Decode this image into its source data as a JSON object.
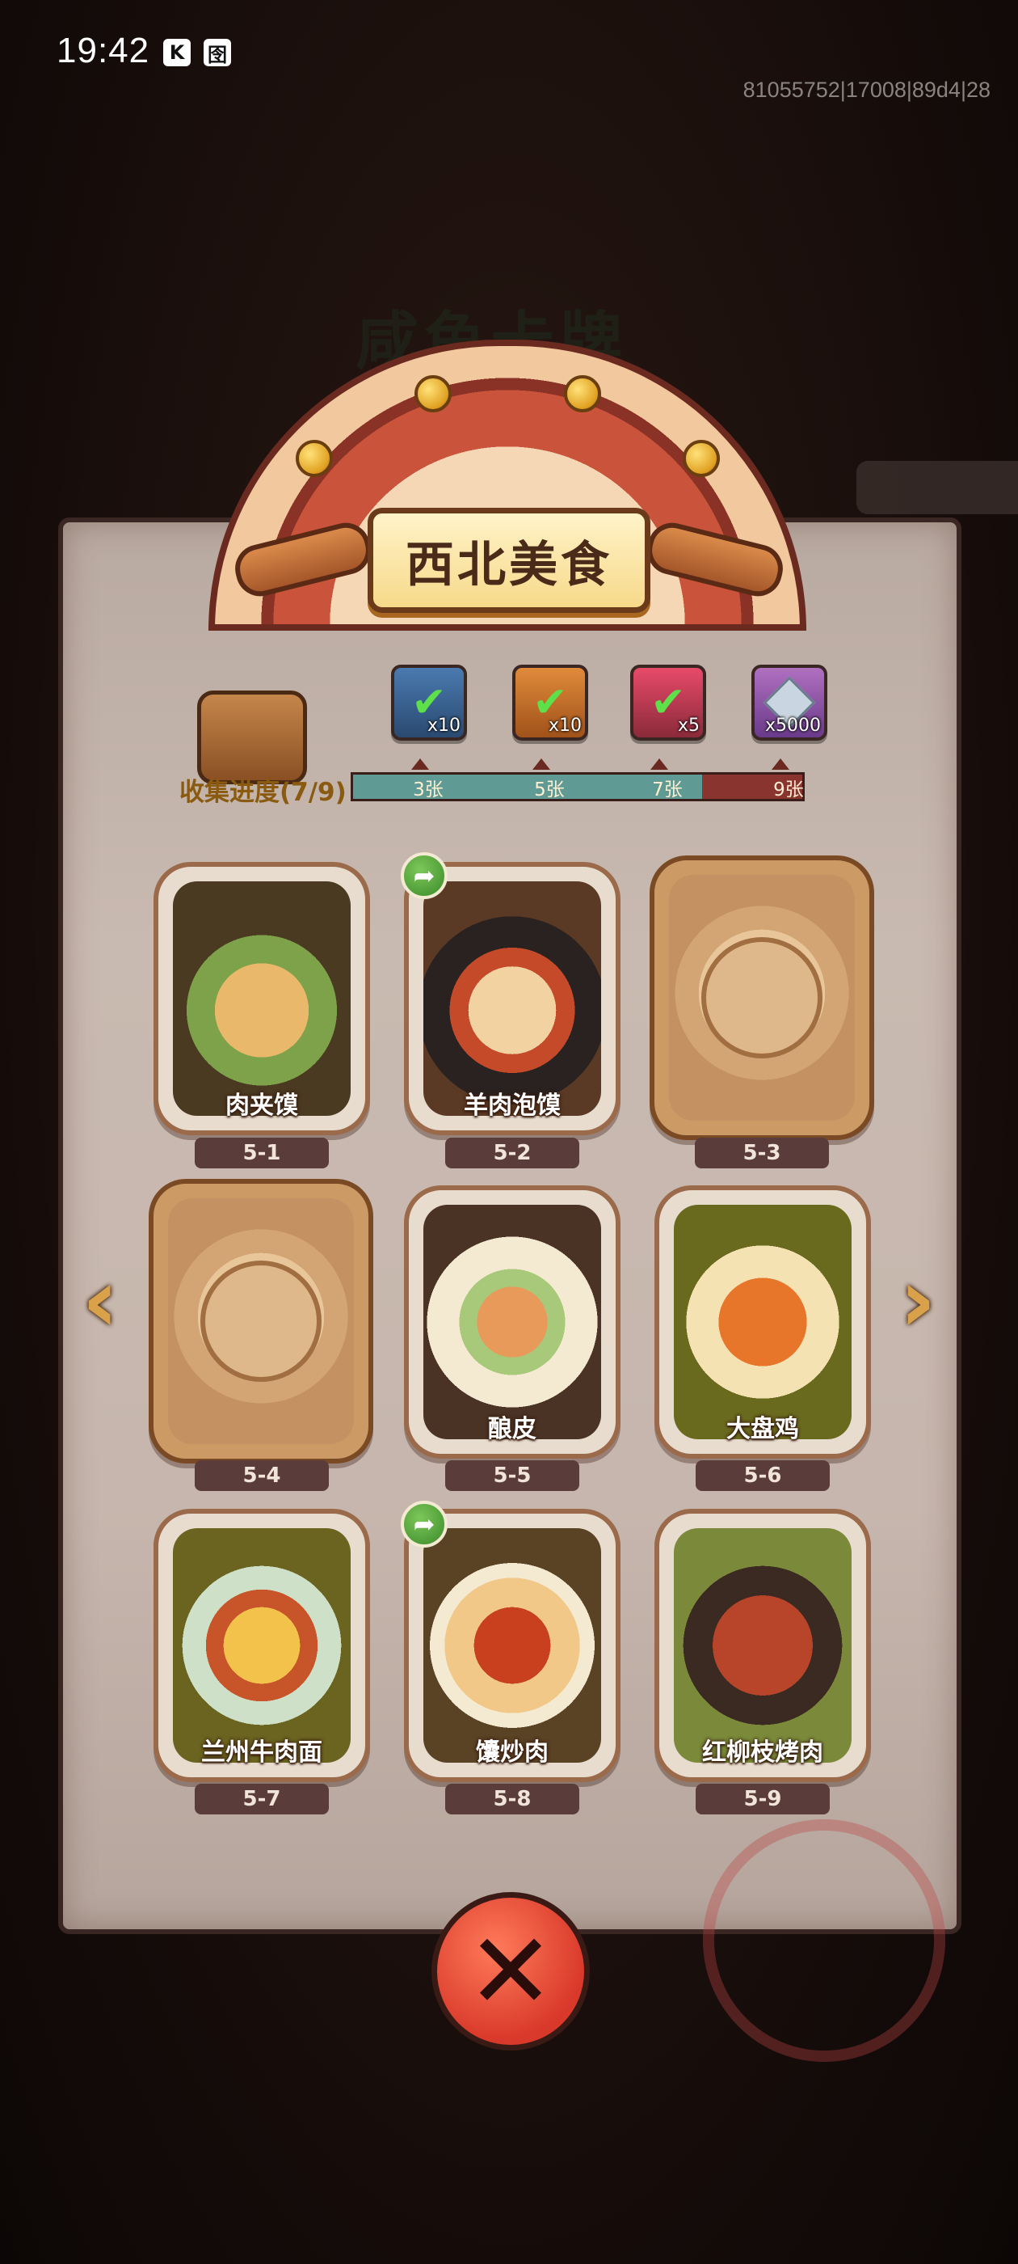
{
  "status_bar": {
    "time": "19:42",
    "icons": [
      "K",
      "囹"
    ],
    "build_info": "81055752|17008|89d4|28"
  },
  "background": {
    "title": "咸鱼卡牌"
  },
  "dialog": {
    "title": "西北美食",
    "progress": {
      "label": "收集进度(7/9)",
      "collected": 7,
      "total": 9,
      "milestones": [
        {
          "label": "3张",
          "reward_icon": "check-chest-icon",
          "reward_count": "x10",
          "claimed": true
        },
        {
          "label": "5张",
          "reward_icon": "check-key-icon",
          "reward_count": "x10",
          "claimed": true
        },
        {
          "label": "7张",
          "reward_icon": "check-orb-icon",
          "reward_count": "x5",
          "claimed": true
        },
        {
          "label": "9张",
          "reward_icon": "gem-icon",
          "reward_count": "x5000",
          "claimed": false
        }
      ]
    },
    "cards": [
      {
        "name": "肉夹馍",
        "id": "5-1",
        "unlocked": true,
        "share": false
      },
      {
        "name": "羊肉泡馍",
        "id": "5-2",
        "unlocked": true,
        "share": true
      },
      {
        "name": "",
        "id": "5-3",
        "unlocked": false,
        "share": false
      },
      {
        "name": "",
        "id": "5-4",
        "unlocked": false,
        "share": false
      },
      {
        "name": "酿皮",
        "id": "5-5",
        "unlocked": true,
        "share": false
      },
      {
        "name": "大盘鸡",
        "id": "5-6",
        "unlocked": true,
        "share": false
      },
      {
        "name": "兰州牛肉面",
        "id": "5-7",
        "unlocked": true,
        "share": false
      },
      {
        "name": "馕炒肉",
        "id": "5-8",
        "unlocked": true,
        "share": true
      },
      {
        "name": "红柳枝烤肉",
        "id": "5-9",
        "unlocked": true,
        "share": false
      }
    ],
    "colors": {
      "card_frame": "#9a6a4a",
      "progress_fill": "#5f9a94",
      "progress_track": "#8a3430",
      "close_button": "#d9392a"
    }
  }
}
